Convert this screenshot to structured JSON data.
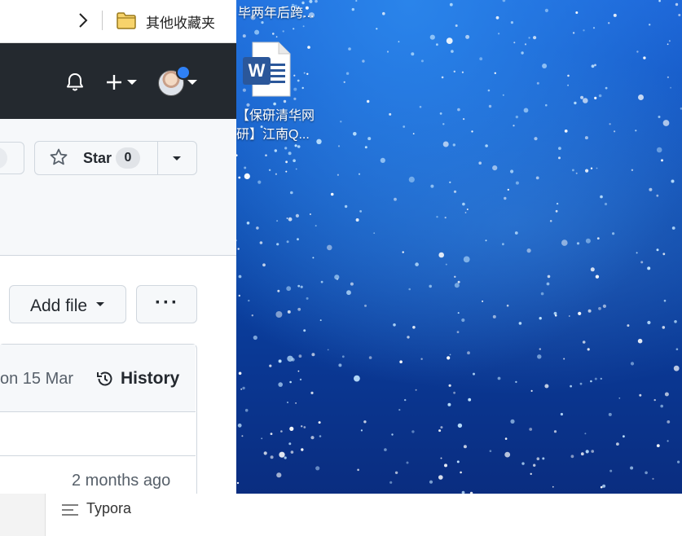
{
  "desktop": {
    "top_label": "毕两年后跨...",
    "icon": {
      "name": "word-document-icon",
      "label_line1": "【保研清华网",
      "label_line2": "研】江南Q..."
    }
  },
  "browser": {
    "bookmarks_bar": {
      "folder_label": "其他收藏夹"
    },
    "repo": {
      "star_label": "Star",
      "star_count": "0",
      "add_file_label": "Add file",
      "more_label": "···",
      "last_commit_date": "on 15 Mar",
      "history_label": "History",
      "file_age": "2 months ago"
    }
  },
  "taskbar": {
    "app_label": "Typora"
  },
  "colors": {
    "header_bg": "#24292f",
    "avatar_dot": "#2f81f7",
    "desktop_blue": "#0b47aa"
  }
}
